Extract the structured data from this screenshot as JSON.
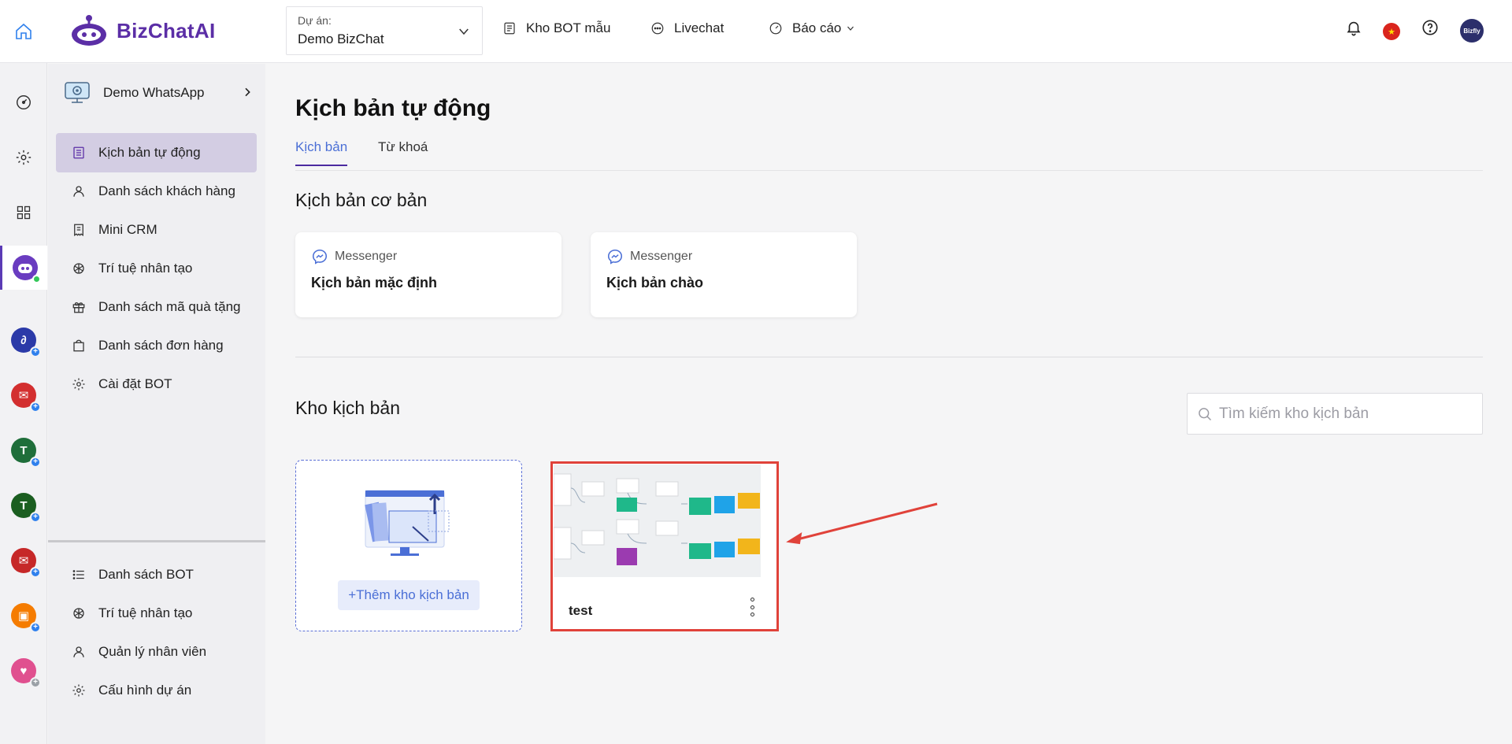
{
  "header": {
    "brand": "BizChatAI",
    "project_label": "Dự án:",
    "project_value": "Demo BizChat",
    "nav": [
      {
        "label": "Kho BOT mẫu"
      },
      {
        "label": "Livechat"
      },
      {
        "label": "Báo cáo"
      }
    ]
  },
  "sidebar": {
    "bot_name": "Demo WhatsApp",
    "items": [
      {
        "label": "Kịch bản tự động"
      },
      {
        "label": "Danh sách khách hàng"
      },
      {
        "label": "Mini CRM"
      },
      {
        "label": "Trí tuệ nhân tạo"
      },
      {
        "label": "Danh sách mã quà tặng"
      },
      {
        "label": "Danh sách đơn hàng"
      },
      {
        "label": "Cài đặt BOT"
      }
    ],
    "bottom_items": [
      {
        "label": "Danh sách BOT"
      },
      {
        "label": "Trí tuệ nhân tạo"
      },
      {
        "label": "Quản lý nhân viên"
      },
      {
        "label": "Cấu hình dự án"
      }
    ]
  },
  "main": {
    "title": "Kịch bản tự động",
    "tabs": [
      {
        "label": "Kịch bản"
      },
      {
        "label": "Từ khoá"
      }
    ],
    "basic_section": "Kịch bản cơ bản",
    "basic_cards": [
      {
        "channel": "Messenger",
        "name": "Kịch bản mặc định"
      },
      {
        "channel": "Messenger",
        "name": "Kịch bản chào"
      }
    ],
    "library_section": "Kho kịch bản",
    "search_placeholder": "Tìm kiếm kho kịch bản",
    "add_label": "+Thêm kho kịch bản",
    "library_cards": [
      {
        "name": "test"
      }
    ]
  },
  "colors": {
    "brand": "#5b2ea6",
    "active_item_bg": "#d3cde3",
    "tab_active": "#4b6fd6",
    "highlight_border": "#e0423a"
  }
}
